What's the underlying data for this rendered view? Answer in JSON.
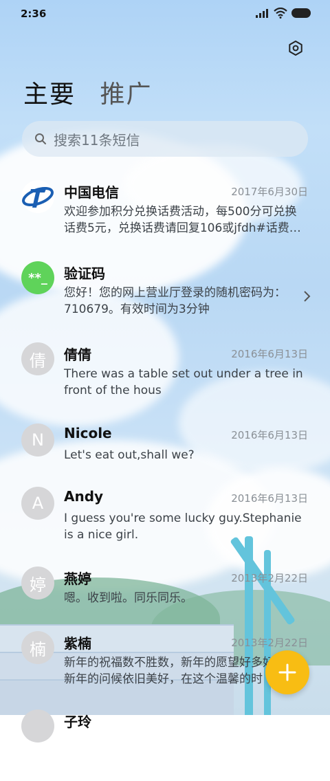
{
  "status": {
    "time": "2:36"
  },
  "tabs": [
    {
      "label": "主要"
    },
    {
      "label": "推广"
    }
  ],
  "search": {
    "placeholder": "搜索11条短信"
  },
  "messages": [
    {
      "name": "中国电信",
      "date": "2017年6月30日",
      "preview": "欢迎参加积分兑换话费活动，每500分可兑换话费5元，兑换话费请回复106或jfdh#话费…",
      "avatar": "telecom-logo"
    },
    {
      "name": "验证码",
      "date": "",
      "preview": "您好！您的网上营业厅登录的随机密码为：710679。有效时间为3分钟",
      "avatar": "**_"
    },
    {
      "name": "倩倩",
      "date": "2016年6月13日",
      "preview": "There was a table set out under a tree in front of the hous",
      "avatar": "倩"
    },
    {
      "name": "Nicole",
      "date": "2016年6月13日",
      "preview": "Let's eat out,shall we?",
      "avatar": "N"
    },
    {
      "name": "Andy",
      "date": "2016年6月13日",
      "preview": "I guess you're some lucky guy.Stephanie is a nice girl.",
      "avatar": "A"
    },
    {
      "name": "燕婷",
      "date": "2013年2月22日",
      "preview": "嗯。收到啦。同乐同乐。",
      "avatar": "婷"
    },
    {
      "name": "紫楠",
      "date": "2013年2月22日",
      "preview": "新年的祝福数不胜数，新年的愿望好多好多，新年的问候依旧美好，在这个温馨的时",
      "avatar": "楠"
    },
    {
      "name": "子玲",
      "date": "",
      "preview": "",
      "avatar": ""
    }
  ],
  "colors": {
    "accent_fab": "#f8bd13",
    "verify_avatar": "#5fd35a",
    "telecom_blue": "#1b5fb3"
  },
  "icons": {
    "settings": "settings-icon",
    "search": "search-icon",
    "compose": "plus-icon",
    "chevron": "chevron-right-icon"
  }
}
